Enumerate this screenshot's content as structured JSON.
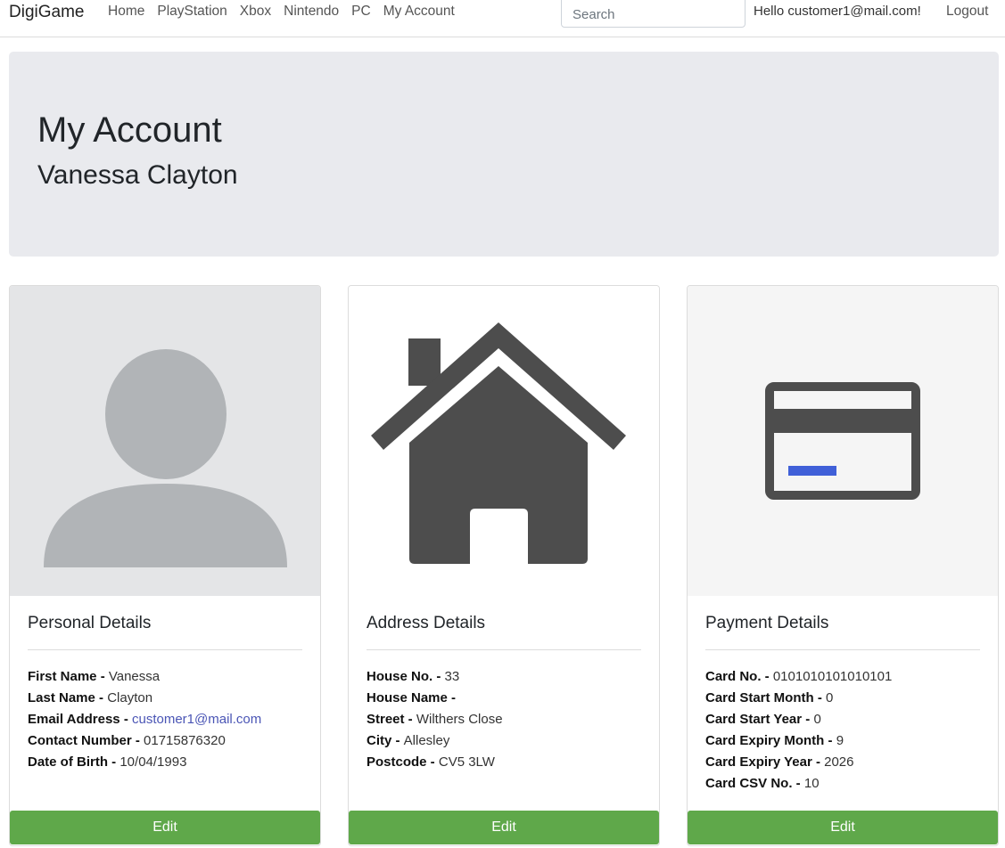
{
  "nav": {
    "brand": "DigiGame",
    "links": [
      "Home",
      "PlayStation",
      "Xbox",
      "Nintendo",
      "PC",
      "My Account"
    ],
    "search_placeholder": "Search",
    "greeting": "Hello customer1@mail.com!",
    "logout": "Logout"
  },
  "header": {
    "title": "My Account",
    "subtitle": "Vanessa Clayton"
  },
  "cards": {
    "personal": {
      "title": "Personal Details",
      "fields": [
        {
          "label": "First Name - ",
          "value": "Vanessa"
        },
        {
          "label": "Last Name - ",
          "value": "Clayton"
        },
        {
          "label": "Email Address - ",
          "value": "customer1@mail.com"
        },
        {
          "label": "Contact Number - ",
          "value": "01715876320"
        },
        {
          "label": "Date of Birth - ",
          "value": "10/04/1993"
        }
      ],
      "edit": "Edit"
    },
    "address": {
      "title": "Address Details",
      "fields": [
        {
          "label": "House No. - ",
          "value": "33"
        },
        {
          "label": "House Name - ",
          "value": ""
        },
        {
          "label": "Street - ",
          "value": "Wilthers Close"
        },
        {
          "label": "City - ",
          "value": "Allesley"
        },
        {
          "label": "Postcode - ",
          "value": "CV5 3LW"
        }
      ],
      "edit": "Edit"
    },
    "payment": {
      "title": "Payment Details",
      "fields": [
        {
          "label": "Card No. - ",
          "value": "0101010101010101"
        },
        {
          "label": "Card Start Month - ",
          "value": "0"
        },
        {
          "label": "Card Start Year - ",
          "value": "0"
        },
        {
          "label": "Card Expiry Month - ",
          "value": "9"
        },
        {
          "label": "Card Expiry Year - ",
          "value": "2026"
        },
        {
          "label": "Card CSV No. - ",
          "value": "10"
        }
      ],
      "edit": "Edit"
    }
  },
  "colors": {
    "edit_button": "#5fa84a",
    "email_link": "#4a55b5",
    "jumbotron_bg": "#e9eaee",
    "icon_dark": "#4d4d4d",
    "avatar_gray": "#b1b4b7",
    "card_stripe": "#4060d8"
  },
  "icons": [
    "user-avatar-icon",
    "house-icon",
    "credit-card-icon"
  ]
}
